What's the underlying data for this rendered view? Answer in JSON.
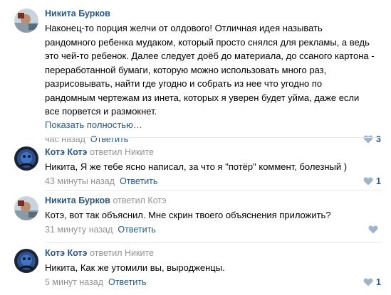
{
  "comments": [
    {
      "author": "Никита Бурков",
      "reply_prefix": "",
      "reply_target": "",
      "text": "Наконец-то порция желчи от олдового! Отличная идея называть\nрандомного ребенка мудаком, который просто снялся для рекламы, а ведь\nэто чей-то ребенок. Далее следует доёб до материала, до ссаного картона -\nпереработанной бумаги, которую можно использовать много раз,\nразрисовывать, найти где угодно и собрать из нее что угодно по\nрандомным чертежам из инета, которых я уверен будет уйма, даже если\nвсе порвется и размокнет.",
      "show_more": "Показать полностью…",
      "time": "час назад",
      "reply_label": "Ответить",
      "likes": "3"
    },
    {
      "author": "Котэ Котэ",
      "reply_prefix": "ответил",
      "reply_target": "Никите",
      "text": "Никита, Я же тебе ясно написал, за что я \"потёр\" коммент, болезный )",
      "time": "43 минуты назад",
      "reply_label": "Ответить",
      "likes": "1"
    },
    {
      "author": "Никита Бурков",
      "reply_prefix": "ответил",
      "reply_target": "Котэ",
      "text": "Котэ, вот так объяснил. Мне скрин твоего объяснения приложить?",
      "time": "31 минуту назад",
      "reply_label": "Ответить",
      "likes": ""
    },
    {
      "author": "Котэ Котэ",
      "reply_prefix": "ответил",
      "reply_target": "Никите",
      "text": "Никита, Как же утомили вы, выродженцы.",
      "time": "5 минут назад",
      "reply_label": "Ответить",
      "likes": "1"
    }
  ],
  "colors": {
    "link": "#2a5885",
    "meta": "#939393",
    "like_icon": "#a0b4cc",
    "divider": "#e7e8ec"
  },
  "icons": {
    "like": "heart-icon"
  }
}
